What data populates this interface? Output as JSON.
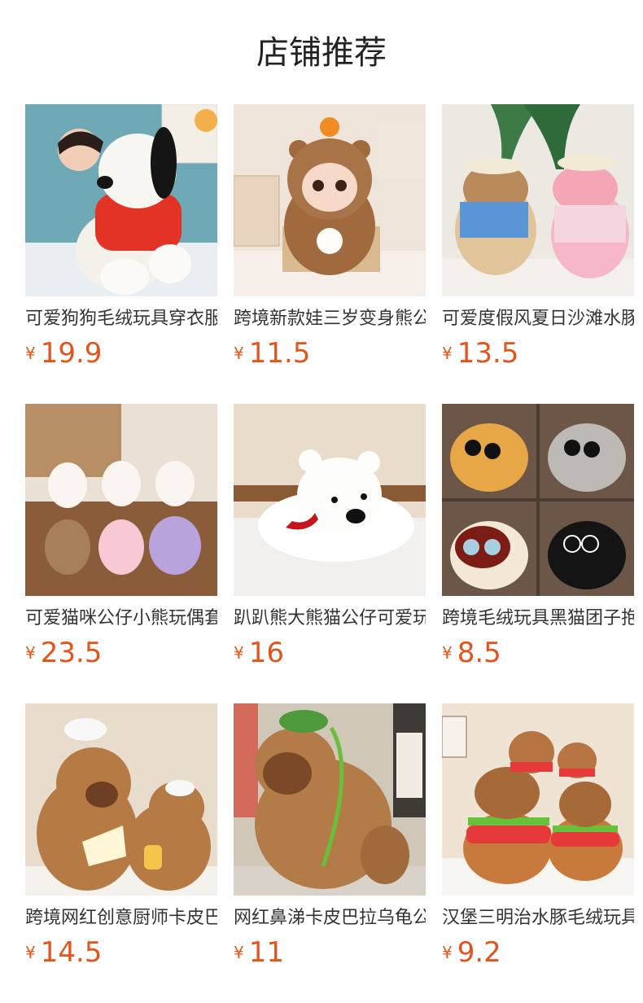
{
  "header": {
    "title": "店铺推荐"
  },
  "products": [
    {
      "name": "可爱狗狗毛绒玩具穿衣服公仔",
      "currency": "¥",
      "price": "19.9",
      "image_icon": "snoopy-plush-image"
    },
    {
      "name": "跨境新款娃三岁变身熊公仔",
      "currency": "¥",
      "price": "11.5",
      "image_icon": "bear-costume-doll-image"
    },
    {
      "name": "可爱度假风夏日沙滩水豚公仔",
      "currency": "¥",
      "price": "13.5",
      "image_icon": "vacation-capybara-image"
    },
    {
      "name": "可爱猫咪公仔小熊玩偶套装",
      "currency": "¥",
      "price": "23.5",
      "image_icon": "cat-bear-set-image"
    },
    {
      "name": "趴趴熊大熊猫公仔可爱玩偶",
      "currency": "¥",
      "price": "16",
      "image_icon": "lying-polar-bear-image"
    },
    {
      "name": "跨境毛绒玩具黑猫团子抱枕",
      "currency": "¥",
      "price": "8.5",
      "image_icon": "round-cat-pillows-image"
    },
    {
      "name": "跨境网红创意厨师卡皮巴拉",
      "currency": "¥",
      "price": "14.5",
      "image_icon": "chef-capybara-image"
    },
    {
      "name": "网红鼻涕卡皮巴拉乌龟公仔",
      "currency": "¥",
      "price": "11",
      "image_icon": "capybara-turtle-image"
    },
    {
      "name": "汉堡三明治水豚毛绒玩具",
      "currency": "¥",
      "price": "9.2",
      "image_icon": "burger-capybara-image"
    }
  ]
}
